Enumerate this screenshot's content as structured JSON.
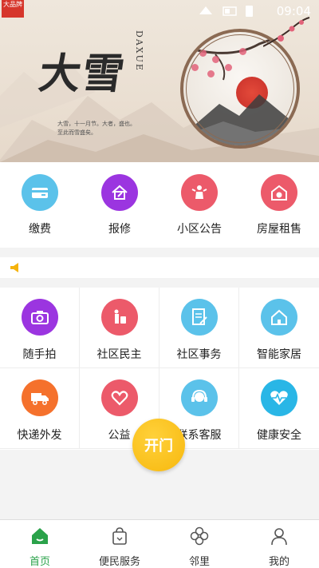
{
  "status_bar": {
    "app_badge": "大品牌",
    "time": "09:04"
  },
  "banner": {
    "title": "大雪",
    "pinyin": "DAXUE",
    "poem_line1": "大雪，十一月节。大者，盛也。",
    "poem_line2": "至此而雪盛矣。"
  },
  "quick_menu": [
    {
      "label": "缴费",
      "icon": "wallet-icon",
      "color": "#5bc2ea"
    },
    {
      "label": "报修",
      "icon": "house-repair-icon",
      "color": "#9b35e0"
    },
    {
      "label": "小区公告",
      "icon": "megaphone-person-icon",
      "color": "#ec5a6a"
    },
    {
      "label": "房屋租售",
      "icon": "house-money-icon",
      "color": "#ec5a6a"
    }
  ],
  "grid": [
    {
      "label": "随手拍",
      "icon": "camera-icon",
      "color": "#9b35e0"
    },
    {
      "label": "社区民主",
      "icon": "person-luggage-icon",
      "color": "#ec5a6a"
    },
    {
      "label": "社区事务",
      "icon": "document-pen-icon",
      "color": "#5bc2ea"
    },
    {
      "label": "智能家居",
      "icon": "home-icon",
      "color": "#5bc2ea"
    },
    {
      "label": "快递外发",
      "icon": "truck-icon",
      "color": "#f5712c"
    },
    {
      "label": "公益",
      "icon": "heart-hands-icon",
      "color": "#ec5a6a"
    },
    {
      "label": "联系客服",
      "icon": "headset-icon",
      "color": "#5bc2ea"
    },
    {
      "label": "健康安全",
      "icon": "heartbeat-icon",
      "color": "#29b6e6"
    }
  ],
  "open_door": {
    "label": "开门",
    "color": "#f7b80e"
  },
  "tabs": [
    {
      "label": "首页",
      "icon": "home-tab-icon",
      "active": true
    },
    {
      "label": "便民服务",
      "icon": "shopping-bag-icon",
      "active": false
    },
    {
      "label": "邻里",
      "icon": "clover-icon",
      "active": false
    },
    {
      "label": "我的",
      "icon": "user-icon",
      "active": false
    }
  ],
  "accent_color": "#2aa24a"
}
